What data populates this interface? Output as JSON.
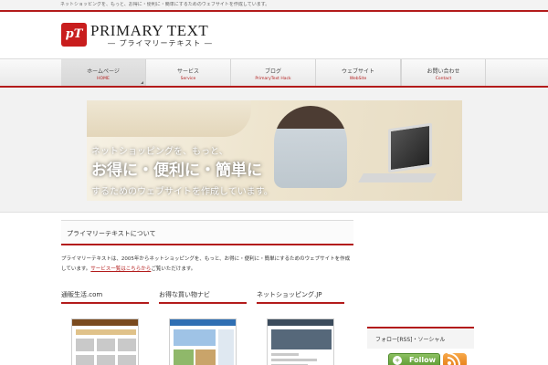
{
  "topbar": {
    "text": "ネットショッピングを、もっと、お得に・便利に・簡単にするためのウェブサイトを作成しています。"
  },
  "header": {
    "logo_mark": "pT",
    "title": "PRIMARY TEXT",
    "subtitle": "― プライマリーテキスト ―"
  },
  "nav": {
    "items": [
      {
        "jp": "ホームページ",
        "en": "HOME"
      },
      {
        "jp": "サービス",
        "en": "Service"
      },
      {
        "jp": "ブログ",
        "en": "PrimaryText Hack"
      },
      {
        "jp": "ウェブサイト",
        "en": "WebSite"
      },
      {
        "jp": "お問い合わせ",
        "en": "Contact"
      }
    ]
  },
  "hero": {
    "line1": "ネットショッピングを、もっと、",
    "line2": "お得に・便利に・簡単に",
    "line3": "するためのウェブサイトを作成しています。"
  },
  "main": {
    "section_title": "プライマリーテキストについて",
    "intro": "プライマリーテキストは、2005年からネットショッピングを、もっと、お得に・便利に・簡単にするためのウェブサイトを作成しています。",
    "intro_link": "サービス一覧はこちらから",
    "intro_tail": "ご覧いただけます。",
    "cards": [
      {
        "title": "通販生活.com"
      },
      {
        "title": "お得な買い物ナビ"
      },
      {
        "title": "ネットショッピング.JP"
      }
    ]
  },
  "sidebar": {
    "widget_title": "フォロー[RSS]・ソーシャル",
    "follow_label": "Follow",
    "follow_icon": "plus-icon",
    "rss_icon": "rss-icon"
  },
  "colors": {
    "accent": "#b31b1b",
    "follow_green": "#5d9a32",
    "rss_orange": "#e57c14"
  }
}
